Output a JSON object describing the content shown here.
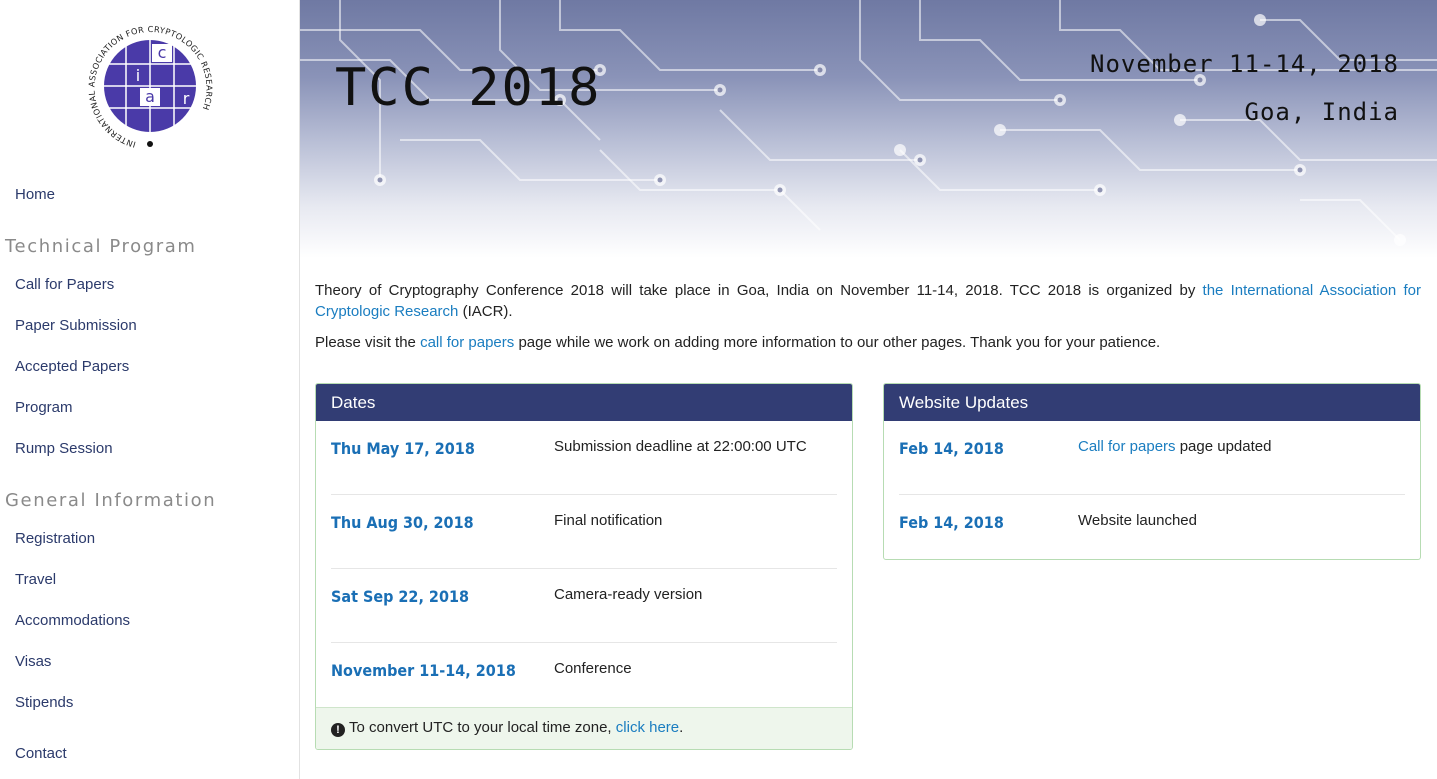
{
  "logo": {
    "ring_text": "INTERNATIONAL ASSOCIATION FOR CRYPTOLOGIC RESEARCH",
    "grid_letters": [
      "i",
      "a",
      "c",
      "r"
    ]
  },
  "sidebar": {
    "home": "Home",
    "technical_heading": "Technical Program",
    "technical_items": [
      "Call for Papers",
      "Paper Submission",
      "Accepted Papers",
      "Program",
      "Rump Session"
    ],
    "general_heading": "General Information",
    "general_items": [
      "Registration",
      "Travel",
      "Accommodations",
      "Visas",
      "Stipends"
    ],
    "contact": "Contact"
  },
  "header": {
    "title": "TCC 2018",
    "dates": "November 11-14, 2018",
    "location": "Goa, India"
  },
  "intro": {
    "text_before_link": "Theory of Cryptography Conference 2018 will take place in Goa, India on November 11-14, 2018. TCC 2018 is organized by ",
    "link_text": "the International Association for Cryptologic Research",
    "text_after_link": " (IACR).",
    "line2_before": "Please visit the ",
    "line2_link": "call for papers",
    "line2_after": " page while we work on adding more information to our other pages. Thank you for your patience."
  },
  "dates_panel": {
    "title": "Dates",
    "rows": [
      {
        "date": "Thu May 17, 2018",
        "desc": "Submission deadline at 22:00:00 UTC"
      },
      {
        "date": "Thu Aug 30, 2018",
        "desc": "Final notification"
      },
      {
        "date": "Sat Sep 22, 2018",
        "desc": "Camera-ready version"
      },
      {
        "date": "November 11-14, 2018",
        "desc": "Conference"
      }
    ],
    "footer_text": "To convert UTC to your local time zone, ",
    "footer_link": "click here",
    "footer_end": "."
  },
  "updates_panel": {
    "title": "Website Updates",
    "rows": [
      {
        "date": "Feb 14, 2018",
        "desc_link": "Call for papers",
        "desc": " page updated"
      },
      {
        "date": "Feb 14, 2018",
        "desc_link": "",
        "desc": "Website launched"
      }
    ]
  },
  "colors": {
    "panel_header": "#323d74",
    "link": "#1a7dc0",
    "nav_link": "#2b3a6b",
    "logo_purple": "#4a3aa8"
  }
}
